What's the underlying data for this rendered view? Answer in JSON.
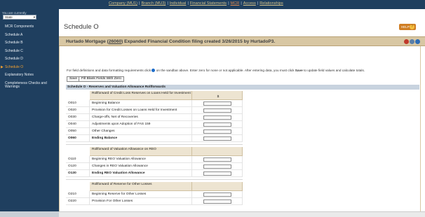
{
  "topnav": {
    "company": "Company (MU1)",
    "branch": "Branch (MU3)",
    "individual": "Individual",
    "financial": "Financial Statements",
    "mcr": "MCR",
    "access": "Access",
    "relationships": "Relationships",
    "separator": "|"
  },
  "sidebar": {
    "currently_label": "You are currently",
    "state_value": "State",
    "items": [
      {
        "label": "MCR Components"
      },
      {
        "label": "Schedule A"
      },
      {
        "label": "Schedule B"
      },
      {
        "label": "Schedule C"
      },
      {
        "label": "Schedule D"
      },
      {
        "label": "Schedule O"
      },
      {
        "label": "Explanatory Notes"
      },
      {
        "label": "Completeness Checks and Warnings"
      }
    ]
  },
  "page": {
    "title": "Schedule O",
    "help_label": "HELP",
    "help_glyph": "?"
  },
  "filing": {
    "prefix": "Hurtado Mortgage (",
    "id": "26060",
    "suffix": ") Expanded Financial Condition filing created 3/26/2015 by HurtadoP3."
  },
  "instructions": {
    "part1": "For field definitions and data formatting requirements click",
    "part2": "on the sandbar above. Enter zero for none or not applicable. After entering data, you must click",
    "save_word": "Save",
    "part3": "to update field values and calculate totals."
  },
  "buttons": {
    "save": "Save",
    "fill_zero": "Fill Blank Fields With Zero"
  },
  "schedule_header": "Schedule O - Reserves and Valuation Allowance Rollforwards",
  "sections": [
    {
      "header": "Rollforward of Credit Loss Reserves on Loans Held for Investment",
      "col_header": "$",
      "rows": [
        {
          "code": "O010",
          "label": "Beginning Balance"
        },
        {
          "code": "O020",
          "label": "Provision for Credit Losses on Loans Held for Investment"
        },
        {
          "code": "O030",
          "label": "Charge-offs, Net of Recoveries"
        },
        {
          "code": "O040",
          "label": "Adjustments upon Adoption of FAS 159"
        },
        {
          "code": "O050",
          "label": "Other Changes"
        },
        {
          "code": "O060",
          "label": "Ending Balance",
          "bold": true
        }
      ]
    },
    {
      "header": "Rollforward of Valuation Allowance on REO",
      "col_header": "",
      "rows": [
        {
          "code": "O110",
          "label": "Beginning REO Valuation Allowance"
        },
        {
          "code": "O120",
          "label": "Changes in REO Valuation Allowance"
        },
        {
          "code": "O130",
          "label": "Ending REO Valuation Allowance",
          "bold": true
        }
      ]
    },
    {
      "header": "Rollforward of Reserve for Other Losses",
      "col_header": "",
      "rows": [
        {
          "code": "O210",
          "label": "Beginning Reserve for Other Losses"
        },
        {
          "code": "O220",
          "label": "Provision For Other Losses"
        }
      ]
    }
  ],
  "colors": {
    "sidebar_bg": "#1f3f5f",
    "filing_bar": "#d8c7a3",
    "accent_orange": "#f0a030",
    "help_button": "#d07e24"
  }
}
